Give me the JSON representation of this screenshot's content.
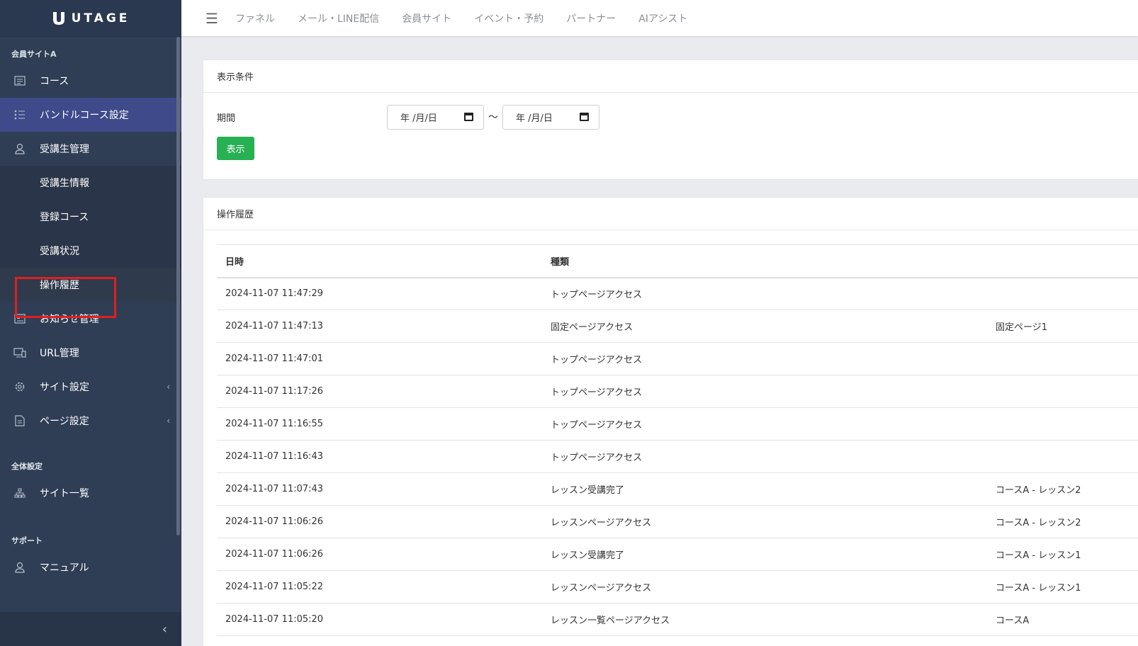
{
  "brand": {
    "name": "UTAGE"
  },
  "sidebar": {
    "sections": [
      {
        "title": "会員サイトA"
      },
      {
        "title": "全体設定"
      },
      {
        "title": "サポート"
      }
    ],
    "items": [
      {
        "label": "コース",
        "icon": "list-doc-icon"
      },
      {
        "label": "バンドルコース設定",
        "icon": "bullet-list-icon"
      },
      {
        "label": "受講生管理",
        "icon": "user-icon"
      },
      {
        "label": "受講生情報"
      },
      {
        "label": "登録コース"
      },
      {
        "label": "受講状況"
      },
      {
        "label": "操作履歴"
      },
      {
        "label": "お知らせ管理",
        "icon": "newspaper-icon"
      },
      {
        "label": "URL管理",
        "icon": "devices-icon"
      },
      {
        "label": "サイト設定",
        "icon": "gear-icon"
      },
      {
        "label": "ページ設定",
        "icon": "page-icon"
      },
      {
        "label": "サイト一覧",
        "icon": "sitemap-icon"
      },
      {
        "label": "マニュアル",
        "icon": "user-icon"
      }
    ]
  },
  "topnav": {
    "links": [
      "ファネル",
      "メール・LINE配信",
      "会員サイト",
      "イベント・予約",
      "パートナー",
      "AIアシスト"
    ]
  },
  "filter": {
    "title": "表示条件",
    "period_label": "期間",
    "date_placeholder": "年 /月/日",
    "separator": "～",
    "show_button": "表示"
  },
  "history": {
    "title": "操作履歴",
    "columns": [
      "日時",
      "種類",
      ""
    ],
    "rows": [
      [
        "2024-11-07 11:47:29",
        "トップページアクセス",
        ""
      ],
      [
        "2024-11-07 11:47:13",
        "固定ページアクセス",
        "固定ページ1"
      ],
      [
        "2024-11-07 11:47:01",
        "トップページアクセス",
        ""
      ],
      [
        "2024-11-07 11:17:26",
        "トップページアクセス",
        ""
      ],
      [
        "2024-11-07 11:16:55",
        "トップページアクセス",
        ""
      ],
      [
        "2024-11-07 11:16:43",
        "トップページアクセス",
        ""
      ],
      [
        "2024-11-07 11:07:43",
        "レッスン受講完了",
        "コースA - レッスン2"
      ],
      [
        "2024-11-07 11:06:26",
        "レッスンページアクセス",
        "コースA - レッスン2"
      ],
      [
        "2024-11-07 11:06:26",
        "レッスン受講完了",
        "コースA - レッスン1"
      ],
      [
        "2024-11-07 11:05:22",
        "レッスンページアクセス",
        "コースA - レッスン1"
      ],
      [
        "2024-11-07 11:05:20",
        "レッスン一覧ページアクセス",
        "コースA"
      ]
    ]
  },
  "colors": {
    "sidebar_bg": "#2f3e55",
    "sidebar_active": "#3e4a8a",
    "primary_button": "#28b054",
    "highlight_box": "#e0201e"
  }
}
